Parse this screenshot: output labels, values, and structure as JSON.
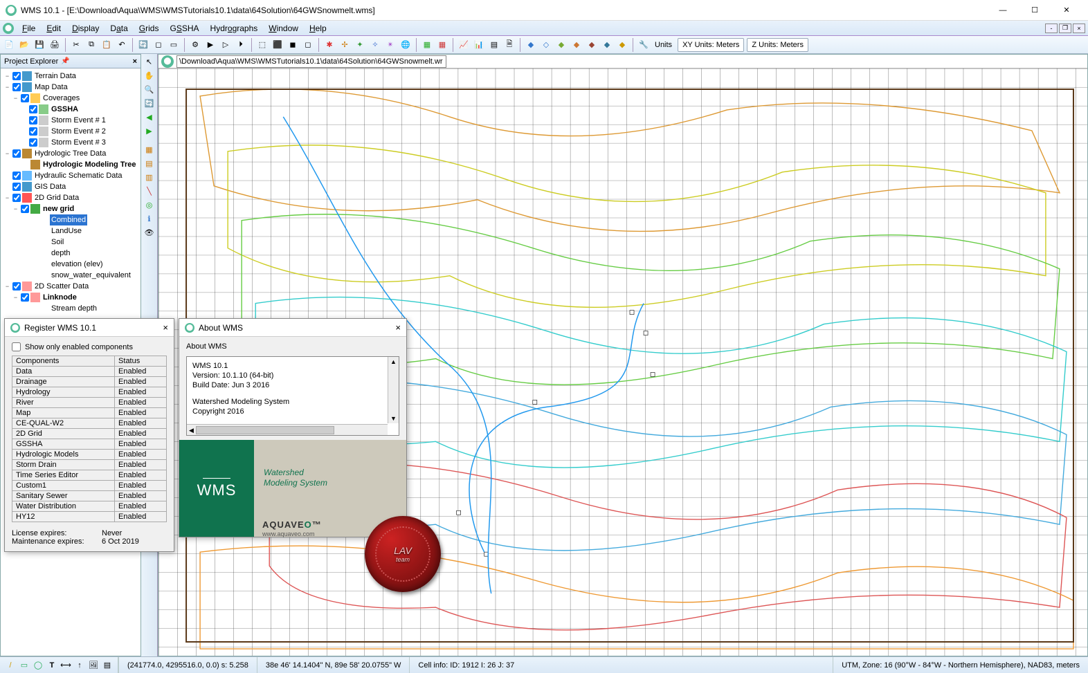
{
  "title": "WMS 10.1 - [E:\\Download\\Aqua\\WMS\\WMSTutorials10.1\\data\\64Solution\\64GWSnowmelt.wms]",
  "menu": {
    "file": "File",
    "edit": "Edit",
    "display": "Display",
    "data": "Data",
    "grids": "Grids",
    "gssha": "GSSHA",
    "hydrographs": "Hydrographs",
    "window": "Window",
    "help": "Help"
  },
  "units": {
    "btn": "Units",
    "xy": "XY Units: Meters",
    "z": "Z Units: Meters"
  },
  "explorer": {
    "title": "Project Explorer",
    "rows": [
      {
        "ind": 0,
        "exp": "−",
        "chk": true,
        "ico": "i-earth",
        "label": "Terrain Data"
      },
      {
        "ind": 0,
        "exp": "−",
        "chk": true,
        "ico": "i-earth",
        "label": "Map Data"
      },
      {
        "ind": 1,
        "exp": "−",
        "chk": true,
        "ico": "i-folder",
        "label": "Coverages"
      },
      {
        "ind": 2,
        "exp": "",
        "chk": true,
        "ico": "i-layer",
        "label": "GSSHA",
        "bold": true
      },
      {
        "ind": 2,
        "exp": "",
        "chk": true,
        "ico": "i-cloud",
        "label": "Storm Event # 1"
      },
      {
        "ind": 2,
        "exp": "",
        "chk": true,
        "ico": "i-cloud",
        "label": "Storm Event # 2"
      },
      {
        "ind": 2,
        "exp": "",
        "chk": true,
        "ico": "i-cloud",
        "label": "Storm Event # 3"
      },
      {
        "ind": 0,
        "exp": "−",
        "chk": true,
        "ico": "i-tree",
        "label": "Hydrologic Tree Data"
      },
      {
        "ind": 1,
        "exp": "",
        "chk": null,
        "ico": "i-tree",
        "label": "Hydrologic Modeling Tree",
        "bold": true
      },
      {
        "ind": 0,
        "exp": "",
        "chk": true,
        "ico": "i-blue",
        "label": "Hydraulic Schematic Data"
      },
      {
        "ind": 0,
        "exp": "",
        "chk": true,
        "ico": "i-earth",
        "label": "GIS Data"
      },
      {
        "ind": 0,
        "exp": "−",
        "chk": true,
        "ico": "i-grid",
        "label": "2D Grid Data"
      },
      {
        "ind": 1,
        "exp": "−",
        "chk": true,
        "ico": "i-grid2",
        "label": "new grid",
        "bold": true
      },
      {
        "ind": 2,
        "exp": "",
        "chk": null,
        "ico": "",
        "label": "Combined",
        "sel": true
      },
      {
        "ind": 2,
        "exp": "",
        "chk": null,
        "ico": "",
        "label": "LandUse"
      },
      {
        "ind": 2,
        "exp": "",
        "chk": null,
        "ico": "",
        "label": "Soil"
      },
      {
        "ind": 2,
        "exp": "",
        "chk": null,
        "ico": "",
        "label": "depth"
      },
      {
        "ind": 2,
        "exp": "",
        "chk": null,
        "ico": "",
        "label": "elevation (elev)"
      },
      {
        "ind": 2,
        "exp": "",
        "chk": null,
        "ico": "",
        "label": "snow_water_equivalent"
      },
      {
        "ind": 0,
        "exp": "−",
        "chk": true,
        "ico": "i-pts",
        "label": "2D Scatter Data"
      },
      {
        "ind": 1,
        "exp": "−",
        "chk": true,
        "ico": "i-pts",
        "label": "Linknode",
        "bold": true
      },
      {
        "ind": 2,
        "exp": "",
        "chk": null,
        "ico": "",
        "label": "Stream depth"
      }
    ]
  },
  "path": "\\Download\\Aqua\\WMS\\WMSTutorials10.1\\data\\64Solution\\64GWSnowmelt.wr",
  "register": {
    "title": "Register WMS 10.1",
    "showonly": "Show only enabled components",
    "headers": {
      "c": "Components",
      "s": "Status"
    },
    "rows": [
      {
        "c": "Data",
        "s": "Enabled"
      },
      {
        "c": "Drainage",
        "s": "Enabled"
      },
      {
        "c": "Hydrology",
        "s": "Enabled"
      },
      {
        "c": "River",
        "s": "Enabled"
      },
      {
        "c": "Map",
        "s": "Enabled"
      },
      {
        "c": "CE-QUAL-W2",
        "s": "Enabled"
      },
      {
        "c": "2D Grid",
        "s": "Enabled"
      },
      {
        "c": "GSSHA",
        "s": "Enabled"
      },
      {
        "c": "Hydrologic Models",
        "s": "Enabled"
      },
      {
        "c": "Storm Drain",
        "s": "Enabled"
      },
      {
        "c": "Time Series Editor",
        "s": "Enabled"
      },
      {
        "c": "Custom1",
        "s": "Enabled"
      },
      {
        "c": "Sanitary Sewer",
        "s": "Enabled"
      },
      {
        "c": "Water Distribution",
        "s": "Enabled"
      },
      {
        "c": "HY12",
        "s": "Enabled"
      }
    ],
    "lic_k": "License expires:",
    "lic_v": "Never",
    "maint_k": "Maintenance expires:",
    "maint_v": "6 Oct 2019"
  },
  "about": {
    "title": "About WMS",
    "heading": "About WMS",
    "l1": "WMS 10.1",
    "l2": "Version: 10.1.10 (64-bit)",
    "l3": "Build Date: Jun  3 2016",
    "l4": "Watershed Modeling System",
    "l5": "Copyright 2016",
    "logo": "WMS",
    "tag1": "Watershed",
    "tag2": "Modeling System",
    "brand": "AQUAVEO",
    "url": "www.aquaveo.com",
    "seal": "LAV",
    "seal2": "team"
  },
  "status": {
    "coord": "(241774.0, 4295516.0, 0.0) s: 5.258",
    "latlon": "38e 46' 14.1404\" N, 89e 58' 20.0755\" W",
    "cell": "Cell info:  ID: 1912    I: 26  J: 37",
    "proj": "UTM, Zone: 16 (90°W - 84°W - Northern Hemisphere), NAD83, meters"
  }
}
